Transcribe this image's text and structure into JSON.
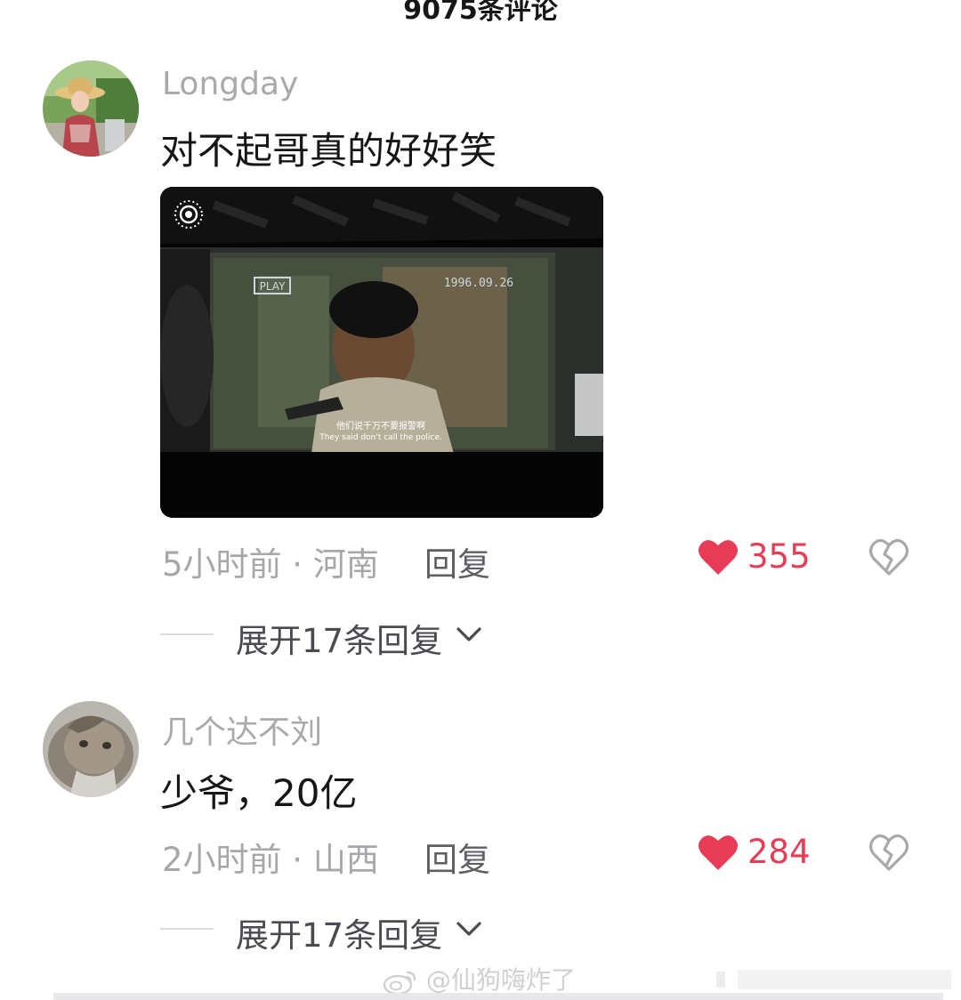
{
  "header": {
    "title": "9075条评论"
  },
  "comments": [
    {
      "username": "Longday",
      "text": "对不起哥真的好好笑",
      "meta": "5小时前 · 河南",
      "reply_label": "回复",
      "likes": "355",
      "expand_label": "展开17条回复",
      "has_media": true,
      "media": {
        "osd_play": "PLAY",
        "osd_date": "1996.09.26",
        "subtitle_cn": "他们说千万不要报警啊",
        "subtitle_en": "They said don't call the police."
      }
    },
    {
      "username": "几个达不刘",
      "text": "少爷，20亿",
      "meta": "2小时前 · 山西",
      "reply_label": "回复",
      "likes": "284",
      "expand_label": "展开17条回复",
      "has_media": false
    }
  ],
  "watermark": {
    "text": "@仙狗嗨炸了"
  },
  "colors": {
    "like_red": "#e83b55",
    "username_gray": "#a9a9ae",
    "meta_gray": "#a7a7ab",
    "text_dark": "#161616"
  },
  "icons": {
    "like": "heart-filled-icon",
    "dislike": "broken-heart-icon",
    "expand": "chevron-down-icon",
    "live_photo": "live-photo-icon",
    "weibo": "weibo-logo-icon"
  }
}
